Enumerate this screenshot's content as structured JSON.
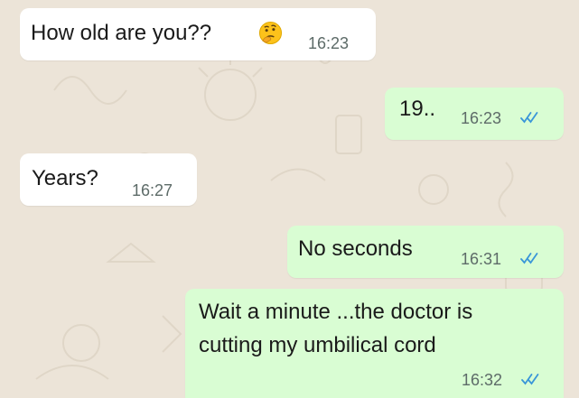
{
  "chat": {
    "messages": [
      {
        "direction": "incoming",
        "text": "How old are you??",
        "emoji": "thinking-face-emoji",
        "time": "16:23"
      },
      {
        "direction": "outgoing",
        "text": "19..",
        "time": "16:23",
        "status": "read"
      },
      {
        "direction": "incoming",
        "text": "Years?",
        "time": "16:27"
      },
      {
        "direction": "outgoing",
        "text": "No seconds",
        "time": "16:31",
        "status": "read"
      },
      {
        "direction": "outgoing",
        "lines": [
          "Wait a minute ...the doctor is",
          "cutting my umbilical cord"
        ],
        "time": "16:32",
        "status": "read"
      }
    ]
  },
  "colors": {
    "background": "#ece4d8",
    "incoming_bubble": "#ffffff",
    "outgoing_bubble": "#d9fdd3",
    "read_tick": "#3a96d8",
    "timestamp": "#5d6b68"
  }
}
